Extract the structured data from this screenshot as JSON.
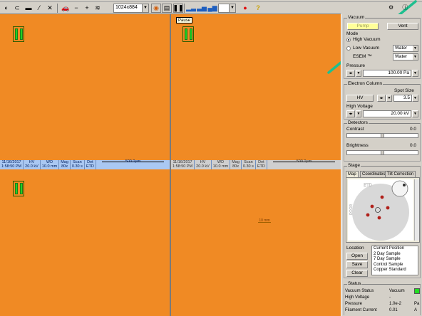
{
  "toolbar": {
    "resolution": "1024x884",
    "tooltip": "Pause"
  },
  "quadrants": [
    {
      "date": "11/16/2017",
      "time": "1:58:50 PM",
      "hv": "20.0 kV",
      "wd": "10.0 mm",
      "mag": "80x",
      "scan": "0.30 s",
      "det": "ETD",
      "scale": "500.0µm"
    },
    {
      "date": "11/16/2017",
      "time": "1:58:50 PM",
      "hv": "20.0 kV",
      "wd": "10.0 mm",
      "mag": "80x",
      "scan": "0.30 s",
      "det": "ETD",
      "scale": "500.0µm"
    }
  ],
  "databar_headers": {
    "hv": "HV",
    "wd": "WD",
    "mag": "Mag",
    "scan": "Scan",
    "det": "Det"
  },
  "quad4_label": "10 mm",
  "panel": {
    "vacuum": {
      "title": "Vacuum",
      "pump": "Pump",
      "vent": "Vent",
      "mode_title": "Mode",
      "high_vacuum": "High Vacuum",
      "low_vacuum": "Low Vacuum",
      "esem": "ESEM ™",
      "gas1": "Water",
      "gas2": "Water",
      "pressure_title": "Pressure",
      "pressure_value": "100.00 Pa"
    },
    "column": {
      "title": "Electron Column",
      "spot_size_label": "Spot Size",
      "hv_button": "HV",
      "spot_size_value": "3.5",
      "high_voltage_label": "High Voltage",
      "high_voltage_value": "20.00 kV"
    },
    "detectors": {
      "title": "Detectors",
      "contrast_label": "Contrast",
      "contrast_value": "0.0",
      "contrast_level": 0.5,
      "brightness_label": "Brightness",
      "brightness_value": "0.0",
      "brightness_level": 0.5
    },
    "stage": {
      "title": "Stage",
      "tabs": [
        "Map",
        "Coordinates",
        "Tilt Correction"
      ],
      "map_detector": "ETD",
      "map_door": "DOOR",
      "location_label": "Location",
      "open": "Open",
      "save": "Save",
      "clear": "Clear",
      "locations": [
        "Current Position",
        "2 Day Sample",
        "7 Day Sample",
        "Control Sample",
        "Copper Standard"
      ]
    },
    "status": {
      "title": "Status",
      "rows": [
        {
          "label": "Vacuum Status",
          "value": "Vacuum",
          "unit": ""
        },
        {
          "label": "High Voltage",
          "value": "-",
          "unit": ""
        },
        {
          "label": "Pressure",
          "value": "1.0e-2",
          "unit": "Pa"
        },
        {
          "label": "Filament Current",
          "value": "0.01",
          "unit": "A"
        }
      ],
      "vacuum_color": "#22dd22"
    }
  },
  "colors": {
    "image_background": "#f08a24",
    "annotation_arrow": "#1fbf8f"
  }
}
